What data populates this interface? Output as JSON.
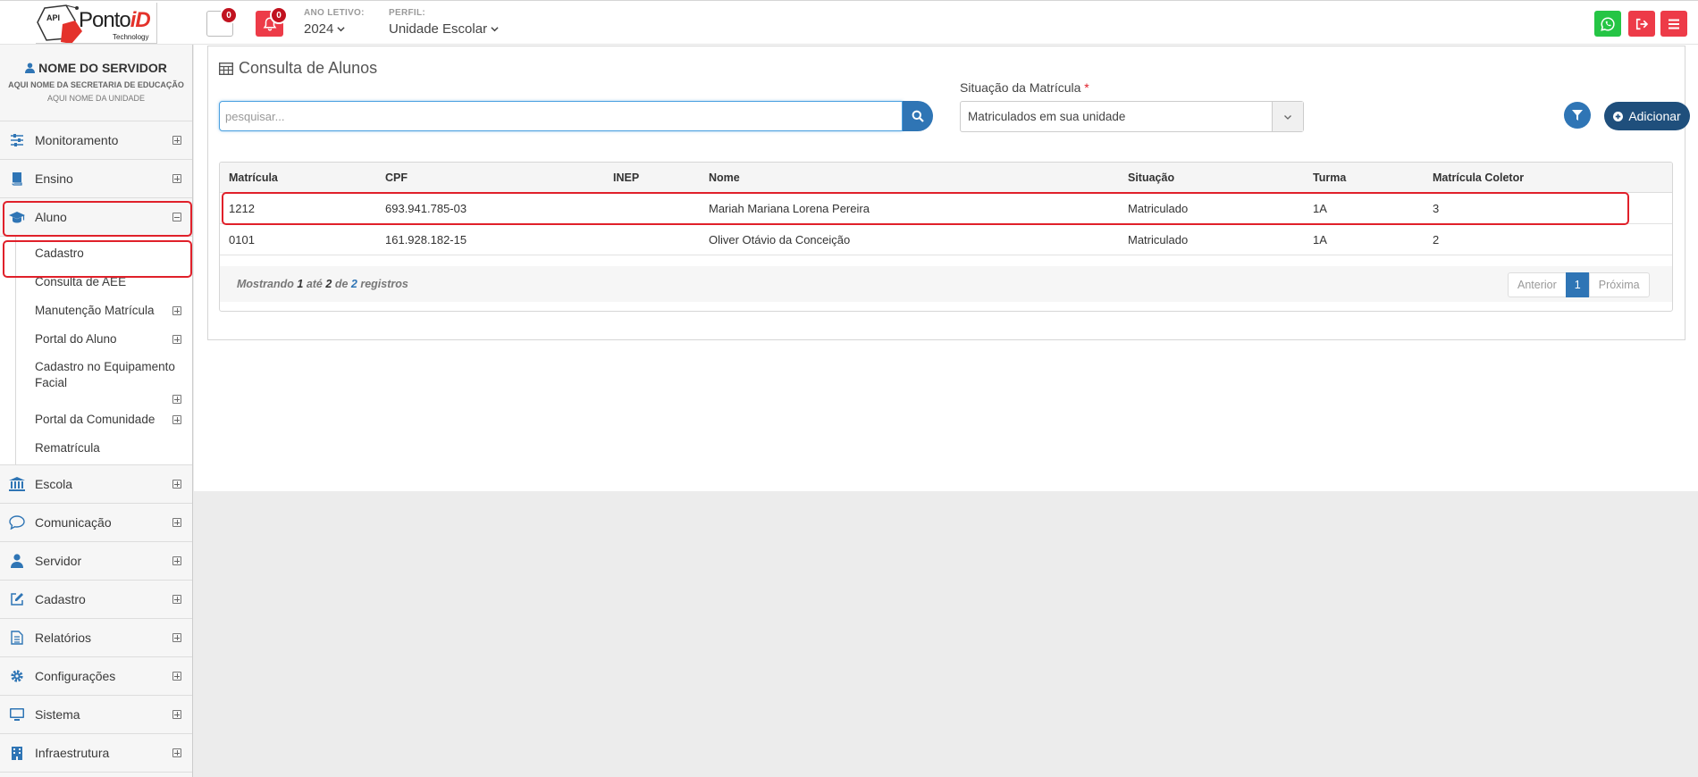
{
  "header": {
    "logo": {
      "api": "API",
      "brand_main": "Ponto",
      "brand_id": "iD",
      "tagline": "Technology"
    },
    "notifications": {
      "box_count": "0",
      "bell_count": "0"
    },
    "year": {
      "label": "ANO LETIVO:",
      "value": "2024"
    },
    "profile": {
      "label": "PERFIL:",
      "value": "Unidade Escolar"
    },
    "colors": {
      "whatsapp": "#25c545",
      "exit": "#ed3b48",
      "menu": "#ed3b48"
    }
  },
  "sidebar": {
    "server_name": "NOME DO SERVIDOR",
    "secretaria": "AQUI NOME DA SECRETARIA DE EDUCAÇÃO",
    "unidade": "AQUI NOME DA UNIDADE",
    "items": [
      {
        "label": "Monitoramento",
        "icon": "sliders-icon"
      },
      {
        "label": "Ensino",
        "icon": "book-icon"
      },
      {
        "label": "Aluno",
        "icon": "graduation-cap-icon",
        "expanded": true
      },
      {
        "label": "Escola",
        "icon": "bank-icon"
      },
      {
        "label": "Comunicação",
        "icon": "speech-bubble-icon"
      },
      {
        "label": "Servidor",
        "icon": "user-icon"
      },
      {
        "label": "Cadastro",
        "icon": "edit-icon"
      },
      {
        "label": "Relatórios",
        "icon": "document-icon"
      },
      {
        "label": "Configurações",
        "icon": "gear-icon"
      },
      {
        "label": "Sistema",
        "icon": "monitor-icon"
      },
      {
        "label": "Infraestrutura",
        "icon": "building-icon"
      }
    ],
    "aluno_sub": [
      {
        "label": "Cadastro"
      },
      {
        "label": "Consulta de AEE"
      },
      {
        "label": "Manutenção Matrícula"
      },
      {
        "label": "Portal do Aluno"
      },
      {
        "label": "Cadastro no Equipamento Facial"
      },
      {
        "label": "Portal da Comunidade"
      },
      {
        "label": "Rematrícula"
      }
    ]
  },
  "main": {
    "title": "Consulta de Alunos",
    "search_placeholder": "pesquisar...",
    "situacao": {
      "label": "Situação da Matrícula",
      "required_mark": "*",
      "value": "Matriculados em sua unidade"
    },
    "add_label": "Adicionar",
    "table": {
      "columns": [
        "Matrícula",
        "CPF",
        "INEP",
        "Nome",
        "Situação",
        "Turma",
        "Matrícula Coletor"
      ],
      "rows": [
        [
          "1212",
          "693.941.785-03",
          "",
          "Mariah Mariana Lorena Pereira",
          "Matriculado",
          "1A",
          "3"
        ],
        [
          "0101",
          "161.928.182-15",
          "",
          "Oliver Otávio da Conceição",
          "Matriculado",
          "1A",
          "2"
        ]
      ]
    },
    "footer": {
      "prefix": "Mostrando",
      "from": "1",
      "mid": "até",
      "to": "2",
      "of": "de",
      "total": "2",
      "suffix": "registros"
    },
    "pagination": {
      "prev": "Anterior",
      "current": "1",
      "next": "Próxima"
    }
  },
  "theme": {
    "primary": "#2f75b5",
    "dark_primary": "#1f4f7c",
    "highlight": "#e0202a"
  }
}
